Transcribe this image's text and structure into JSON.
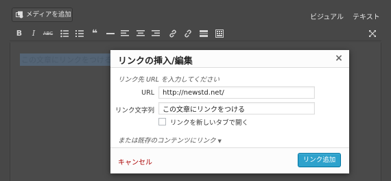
{
  "editor": {
    "media_button_label": "メディアを追加",
    "tabs": {
      "visual": "ビジュアル",
      "text": "テキスト"
    },
    "toolbar": {
      "bold": "B",
      "italic": "I",
      "strike": "ABC",
      "quote": "❝"
    },
    "content_text": "この文章にリンクをつける"
  },
  "modal": {
    "title": "リンクの挿入/編集",
    "close_glyph": "×",
    "instructions": "リンク先 URL を入力してください",
    "url": {
      "label": "URL",
      "value": "http://newstd.net/"
    },
    "link_text": {
      "label": "リンク文字列",
      "value": "この文章にリンクをつける"
    },
    "new_tab": {
      "label": "リンクを新しいタブで開く",
      "checked": false
    },
    "existing_link_toggle": "または既存のコンテンツにリンク",
    "existing_link_arrow": "▼",
    "cancel_label": "キャンセル",
    "submit_label": "リンク追加"
  },
  "colors": {
    "overlay": "#474747",
    "primary_button": "#2ea2cc",
    "cancel_text": "#aa0000"
  }
}
